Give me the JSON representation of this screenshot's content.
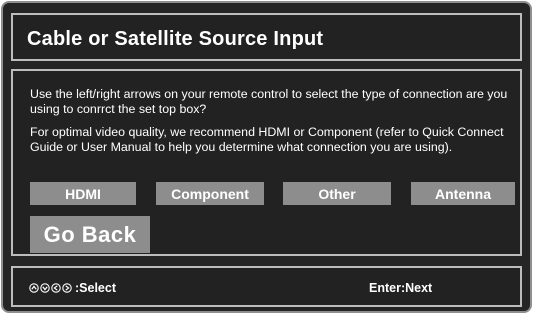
{
  "header": {
    "title": "Cable or Satellite Source Input"
  },
  "body": {
    "instruction": "Use the left/right arrows on your remote control to select the type of connection are you using to conrrct the set top box?",
    "recommendation": "For optimal video quality, we recommend HDMI or Component (refer to Quick Connect Guide or User Manual to help you determine what connection you are using).",
    "options": [
      {
        "label": "HDMI"
      },
      {
        "label": "Component"
      },
      {
        "label": "Other"
      },
      {
        "label": "Antenna"
      }
    ],
    "back_label": "Go Back"
  },
  "footer": {
    "select_icons": [
      "up-arrow-icon",
      "down-arrow-icon",
      "left-arrow-icon",
      "right-arrow-icon"
    ],
    "select_label": ":Select",
    "next_label": "Enter:Next"
  },
  "colors": {
    "background": "#252525",
    "border": "#bdbdbd",
    "button": "#8d8d8d",
    "text": "#ffffff"
  }
}
